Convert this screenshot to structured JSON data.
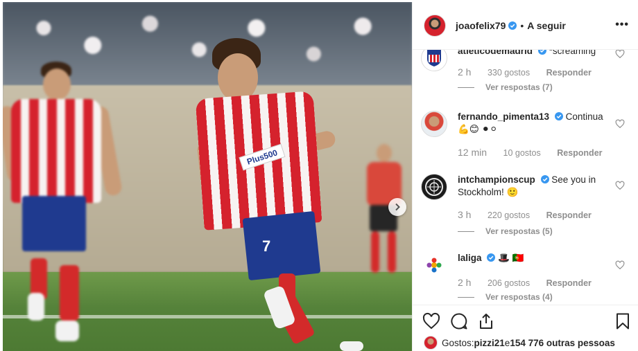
{
  "post": {
    "username": "joaofelix79",
    "follow_label": "A seguir",
    "separator": "•",
    "more_label": "•••",
    "jersey_number": "7",
    "sponsor": "Plus500"
  },
  "comments": [
    {
      "username": "atleticodemadrid",
      "text": "*screaming",
      "time": "2 h",
      "likes": "330 gostos",
      "reply": "Responder",
      "view_replies": "Ver respostas (7)"
    },
    {
      "username": "fernando_pimenta13",
      "text": "Continua 💪😊 ⚫⚪",
      "time": "12 min",
      "likes": "10 gostos",
      "reply": "Responder",
      "view_replies": ""
    },
    {
      "username": "intchampionscup",
      "text": "See you in Stockholm! 🙂",
      "time": "3 h",
      "likes": "220 gostos",
      "reply": "Responder",
      "view_replies": "Ver respostas (5)"
    },
    {
      "username": "laliga",
      "text": "🎩 🇵🇹",
      "time": "2 h",
      "likes": "206 gostos",
      "reply": "Responder",
      "view_replies": "Ver respostas (4)"
    }
  ],
  "likes": {
    "prefix": "Gostos: ",
    "user": "pizzi21",
    "middle": " e ",
    "others": "154 776 outras pessoas"
  },
  "colors": {
    "verified": "#3897f0",
    "atletico_red": "#d5222d",
    "muted": "#8e8e8e"
  },
  "icons": [
    "verified-icon",
    "heart-icon",
    "comment-icon",
    "share-icon",
    "bookmark-icon",
    "chevron-right-icon",
    "more-icon"
  ]
}
